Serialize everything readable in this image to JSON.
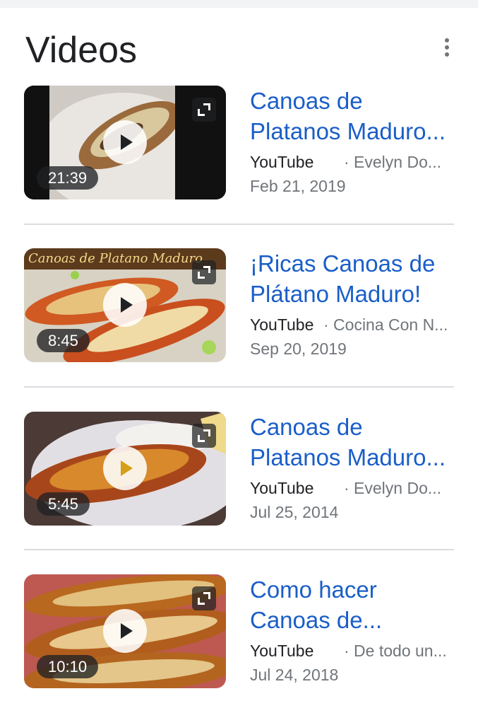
{
  "header": {
    "title": "Videos",
    "more_icon": "more-vert-icon"
  },
  "videos": [
    {
      "title": "Canoas de Platanos Maduro...",
      "source": "YouTube",
      "channel": "· Evelyn Do...",
      "date": "Feb 21, 2019",
      "duration": "21:39"
    },
    {
      "title": "¡Ricas Canoas de Plátano Maduro!",
      "source": "YouTube",
      "channel": "· Cocina Con N...",
      "date": "Sep 20, 2019",
      "duration": "8:45",
      "thumb_caption": "Canoas de Platano Maduro"
    },
    {
      "title": "Canoas de Platanos Maduro...",
      "source": "YouTube",
      "channel": "· Evelyn Do...",
      "date": "Jul 25, 2014",
      "duration": "5:45"
    },
    {
      "title": "Como hacer Canoas de...",
      "source": "YouTube",
      "channel": "· De todo un...",
      "date": "Jul 24, 2018",
      "duration": "10:10"
    }
  ],
  "colors": {
    "link": "#1a5ec8",
    "secondary": "#70757a",
    "primary": "#202124",
    "divider": "#dadce0"
  }
}
